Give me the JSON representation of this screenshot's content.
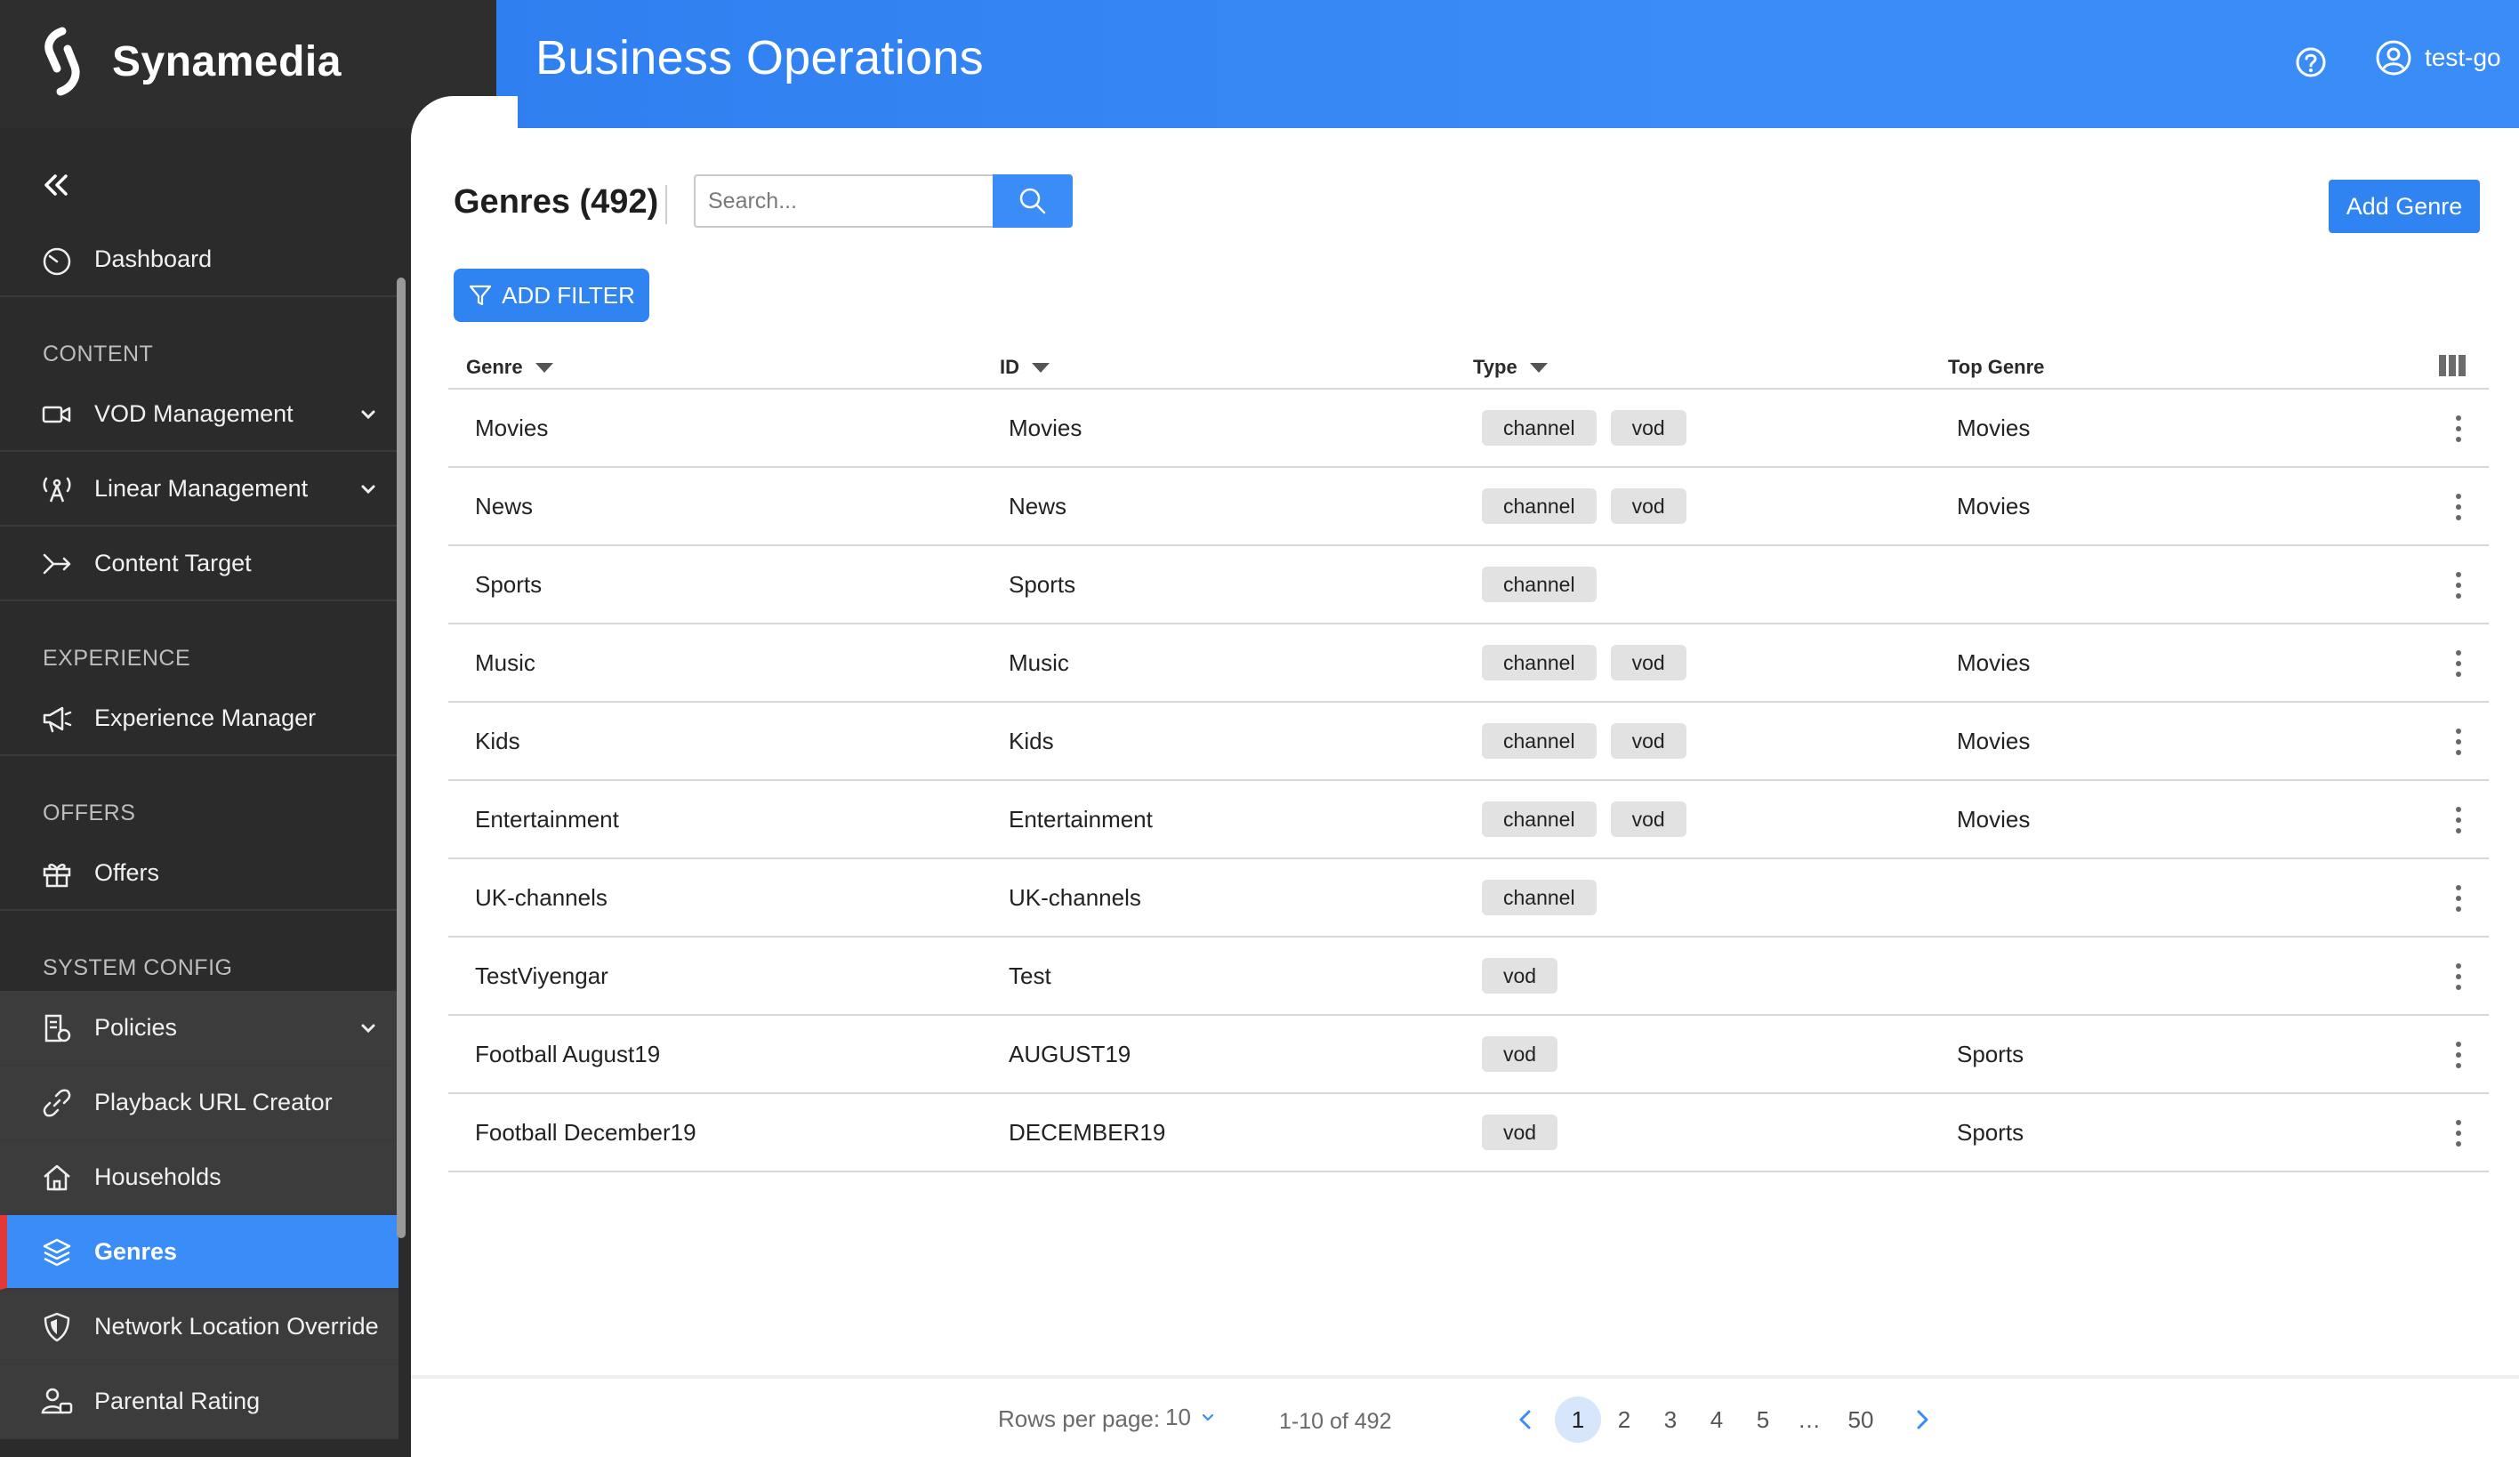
{
  "brand": {
    "name": "Synamedia"
  },
  "header": {
    "title": "Business Operations",
    "user": "test-go"
  },
  "sidebar": {
    "items": [
      {
        "label": "Dashboard"
      },
      {
        "label": "VOD Management"
      },
      {
        "label": "Linear Management"
      },
      {
        "label": "Content Target"
      },
      {
        "label": "Experience Manager"
      },
      {
        "label": "Offers"
      },
      {
        "label": "Policies"
      },
      {
        "label": "Playback URL Creator"
      },
      {
        "label": "Households"
      },
      {
        "label": "Genres"
      },
      {
        "label": "Network Location Override"
      },
      {
        "label": "Parental Rating"
      }
    ],
    "sections": [
      "CONTENT",
      "EXPERIENCE",
      "OFFERS",
      "SYSTEM CONFIG"
    ],
    "active": "Genres"
  },
  "page": {
    "title": "Genres (492)",
    "search_placeholder": "Search...",
    "add_button": "Add Genre",
    "filter_button": "ADD FILTER"
  },
  "table": {
    "columns": [
      "Genre",
      "ID",
      "Type",
      "Top Genre"
    ],
    "rows": [
      {
        "genre": "Movies",
        "id": "Movies",
        "types": [
          "channel",
          "vod"
        ],
        "top": "Movies"
      },
      {
        "genre": "News",
        "id": "News",
        "types": [
          "channel",
          "vod"
        ],
        "top": "Movies"
      },
      {
        "genre": "Sports",
        "id": "Sports",
        "types": [
          "channel"
        ],
        "top": ""
      },
      {
        "genre": "Music",
        "id": "Music",
        "types": [
          "channel",
          "vod"
        ],
        "top": "Movies"
      },
      {
        "genre": "Kids",
        "id": "Kids",
        "types": [
          "channel",
          "vod"
        ],
        "top": "Movies"
      },
      {
        "genre": "Entertainment",
        "id": "Entertainment",
        "types": [
          "channel",
          "vod"
        ],
        "top": "Movies"
      },
      {
        "genre": "UK-channels",
        "id": "UK-channels",
        "types": [
          "channel"
        ],
        "top": ""
      },
      {
        "genre": "TestViyengar",
        "id": "Test",
        "types": [
          "vod"
        ],
        "top": ""
      },
      {
        "genre": "Football August19",
        "id": "AUGUST19",
        "types": [
          "vod"
        ],
        "top": "Sports"
      },
      {
        "genre": "Football December19",
        "id": "DECEMBER19",
        "types": [
          "vod"
        ],
        "top": "Sports"
      }
    ]
  },
  "pagination": {
    "rows_label": "Rows per page:",
    "rows_value": "10",
    "range": "1-10 of 492",
    "pages": [
      "1",
      "2",
      "3",
      "4",
      "5",
      "…",
      "50"
    ],
    "current": "1"
  },
  "colors": {
    "accent": "#3a8cf7",
    "sidebar": "#2b2b2b",
    "active_marker": "#e23838"
  }
}
